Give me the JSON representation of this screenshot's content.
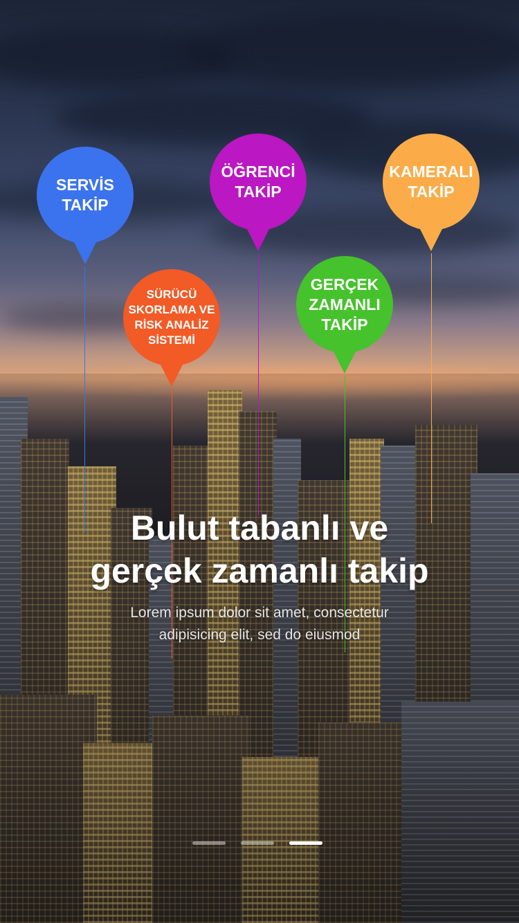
{
  "hero": {
    "headline": "Bulut tabanlı ve\ngerçek zamanlı takip",
    "subtext": "Lorem ipsum dolor sit amet, consectetur\nadipisicing elit, sed do eiusmod"
  },
  "pins": [
    {
      "label": "SERVİS\nTAKİP",
      "color": "#3b73ef"
    },
    {
      "label": "ÖĞRENCİ\nTAKİP",
      "color": "#bb17c2"
    },
    {
      "label": "KAMERALI\nTAKİP",
      "color": "#fbac48"
    },
    {
      "label": "SÜRÜCÜ\nSKORLAMA VE\nRİSK ANALİZ\nSİSTEMİ",
      "color": "#f25a26"
    },
    {
      "label": "GERÇEK\nZAMANLI\nTAKİP",
      "color": "#46c22c"
    }
  ],
  "pagination": {
    "total": 3,
    "active_index": 2
  }
}
